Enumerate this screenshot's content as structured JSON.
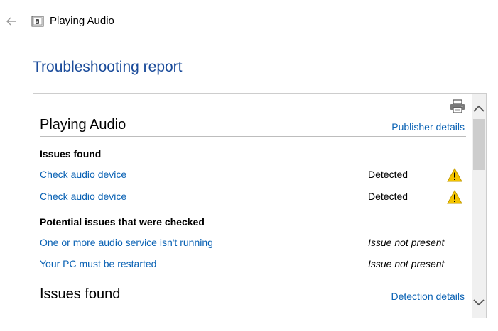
{
  "window": {
    "title": "Playing Audio"
  },
  "page": {
    "title": "Troubleshooting report"
  },
  "report": {
    "section1": {
      "title": "Playing Audio",
      "link": "Publisher details",
      "issues_heading": "Issues found",
      "issues": [
        {
          "name": "Check audio device",
          "status": "Detected",
          "icon": "warning-icon"
        },
        {
          "name": "Check audio device",
          "status": "Detected",
          "icon": "warning-icon"
        }
      ],
      "checked_heading": "Potential issues that were checked",
      "checked": [
        {
          "name": "One or more audio service isn't running",
          "status": "Issue not present"
        },
        {
          "name": "Your PC must be restarted",
          "status": "Issue not present"
        }
      ]
    },
    "section2": {
      "title": "Issues found",
      "link": "Detection details"
    }
  },
  "icons": {
    "back": "back-arrow-icon",
    "app": "audio-troubleshooter-icon",
    "print": "printer-icon",
    "warning": "warning-icon",
    "scroll_up": "chevron-up-icon",
    "scroll_down": "chevron-down-icon"
  },
  "colors": {
    "title_blue": "#1a4b9a",
    "link_blue": "#0a62b4",
    "warning_yellow": "#f4c400"
  }
}
